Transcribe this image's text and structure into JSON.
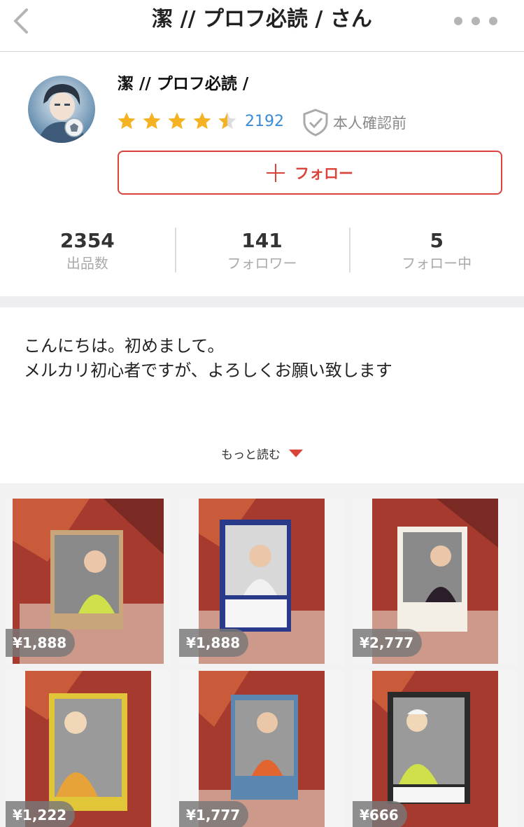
{
  "nav": {
    "title": "潔 // プロフ必読 / さん",
    "back_icon": "chevron-left-icon",
    "more_icon": "ellipsis-icon"
  },
  "profile": {
    "name": "潔 // プロフ必読 /",
    "rating": 4.5,
    "review_count": "2192",
    "verification": "本人確認前",
    "follow_label": "フォロー",
    "colors": {
      "accent": "#d9433a",
      "star": "#f5b324",
      "link": "#3a8bd6"
    }
  },
  "stats": [
    {
      "value": "2354",
      "label": "出品数"
    },
    {
      "value": "141",
      "label": "フォロワー"
    },
    {
      "value": "5",
      "label": "フォロー中"
    }
  ],
  "intro": {
    "line1": "こんにちは。初めまして。",
    "line2": "メルカリ初心者ですが、よろしくお願い致します",
    "more_label": "もっと読む"
  },
  "items": [
    {
      "price": "¥1,888"
    },
    {
      "price": "¥1,888"
    },
    {
      "price": "¥2,777"
    },
    {
      "price": "¥1,222"
    },
    {
      "price": "¥1,777"
    },
    {
      "price": "¥666"
    }
  ]
}
